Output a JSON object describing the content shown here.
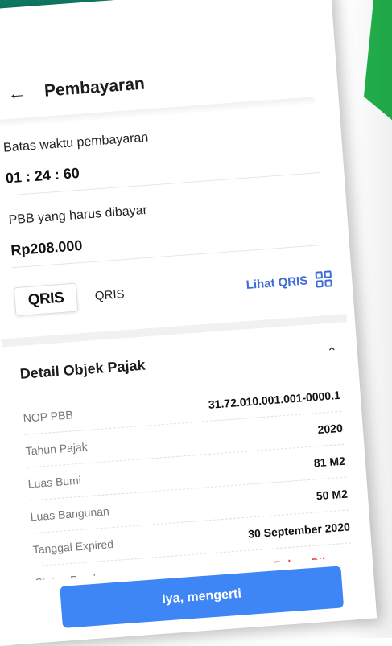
{
  "colors": {
    "accent_green": "#22b14c",
    "dark_green": "#0f7a63",
    "primary_blue": "#3e86f5",
    "link_blue": "#3f6bd8",
    "status_red": "#e53935"
  },
  "header": {
    "back_icon": "arrow-left-icon",
    "title": "Pembayaran"
  },
  "payment": {
    "deadline_label": "Batas waktu pembayaran",
    "deadline_value": "01 : 24 : 60",
    "amount_label": "PBB yang harus dibayar",
    "amount_value": "Rp208.000"
  },
  "method": {
    "logo_text": "QRIS",
    "label": "QRIS",
    "link": "Lihat QRIS",
    "link_icon": "qr-code-icon"
  },
  "detail": {
    "title": "Detail Objek Pajak",
    "toggle_icon": "chevron-up-icon",
    "rows": [
      {
        "label": "NOP PBB",
        "value": "31.72.010.001.001-0000.1"
      },
      {
        "label": "Tahun Pajak",
        "value": "2020"
      },
      {
        "label": "Luas Bumi",
        "value": "81 M2"
      },
      {
        "label": "Luas Bangunan",
        "value": "50 M2"
      },
      {
        "label": "Tanggal Expired",
        "value": "30 September 2020"
      },
      {
        "label": "Status Pembayaran",
        "value": "Belum Dibayar"
      }
    ]
  },
  "footer": {
    "confirm_label": "Iya, mengerti"
  }
}
